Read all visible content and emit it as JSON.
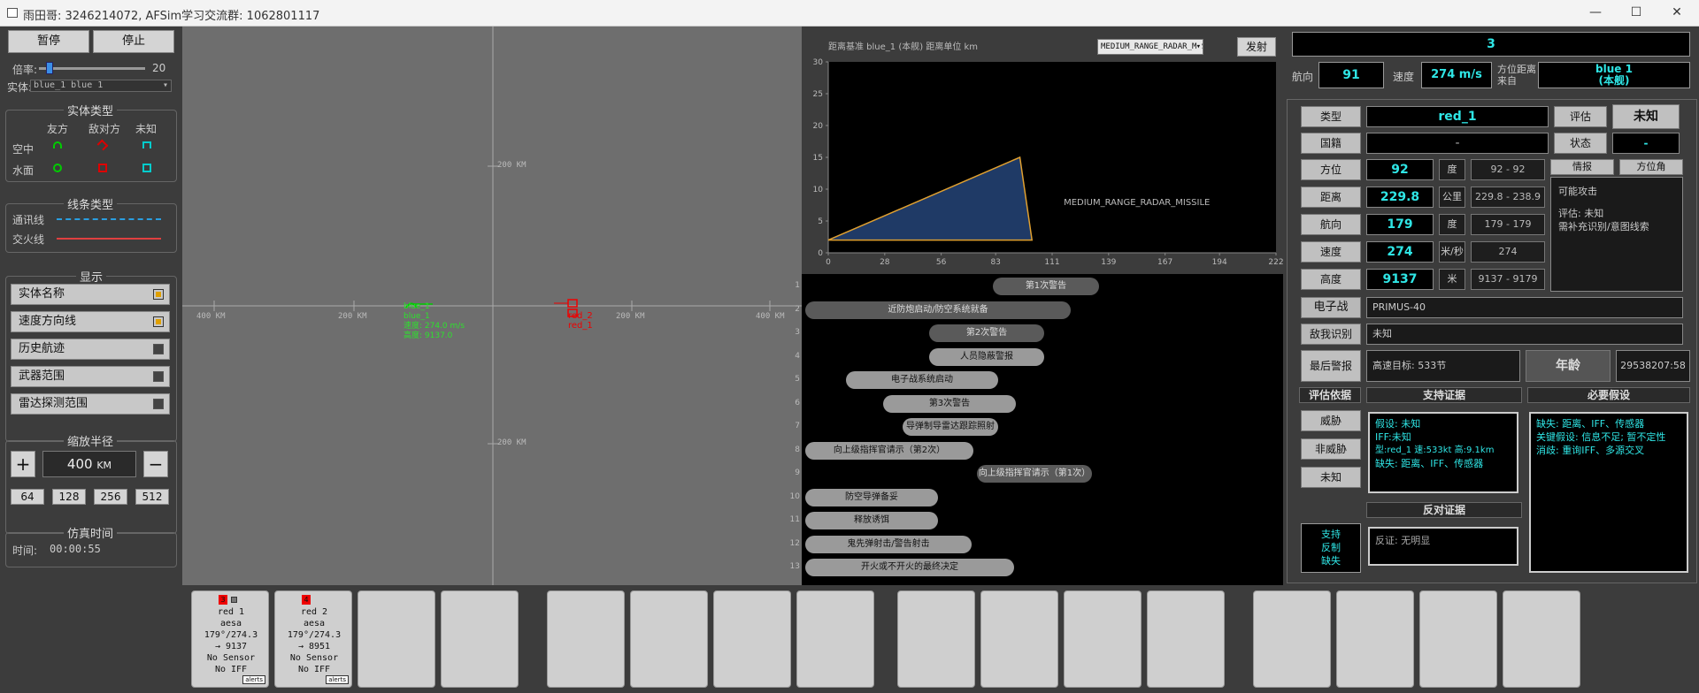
{
  "window": {
    "title": "雨田哥: 3246214072, AFSim学习交流群: 1062801117"
  },
  "left": {
    "pause": "暂停",
    "stop": "停止",
    "rate_label": "倍率:",
    "rate_value": "20",
    "rate_fraction": 0.1,
    "entity_label": "实体:",
    "entity_value": "blue_1 blue 1",
    "entity_types": {
      "title": "实体类型",
      "cols": [
        "友方",
        "敌对方",
        "未知"
      ],
      "rows": [
        "空中",
        "水面"
      ]
    },
    "line_types": {
      "title": "线条类型",
      "comm": "通讯线",
      "engage": "交火线"
    },
    "display": {
      "title": "显示",
      "items": [
        {
          "label": "实体名称",
          "on": true
        },
        {
          "label": "速度方向线",
          "on": true
        },
        {
          "label": "历史航迹",
          "on": false
        },
        {
          "label": "武器范围",
          "on": false
        },
        {
          "label": "雷达探测范围",
          "on": false
        }
      ]
    },
    "zoom": {
      "title": "缩放半径",
      "plus": "+",
      "minus": "−",
      "value": "400",
      "unit": "KM",
      "presets": [
        "64",
        "128",
        "256",
        "512"
      ]
    },
    "sim": {
      "title": "仿真时间",
      "label": "时间:",
      "value": "00:00:55"
    }
  },
  "map": {
    "labels": [
      "400 KM",
      "200 KM",
      "200 KM",
      "400 KM",
      "200 KM",
      "200 KM"
    ],
    "blue": {
      "name": "blue_1",
      "lines": [
        "blue_1",
        "blue_1",
        "速度: 274.0 m/s",
        "高度: 9137.0"
      ]
    },
    "red": [
      "red_2",
      "red_1"
    ]
  },
  "chart": {
    "header": "距离基准 blue_1 (本舰)   距离单位 km",
    "select": "MEDIUM_RANGE_RADAR_MIS",
    "fire": "发射",
    "shape_label": "MEDIUM_RANGE_RADAR_MISSILE",
    "yticks": [
      "0",
      "5",
      "10",
      "15",
      "20",
      "25",
      "30"
    ],
    "xticks": [
      "0",
      "28",
      "56",
      "83",
      "111",
      "139",
      "167",
      "194",
      "222"
    ]
  },
  "chart_data": {
    "type": "area",
    "title": "",
    "xlabel": "",
    "ylabel": "",
    "xlim": [
      0,
      222
    ],
    "ylim": [
      0,
      30
    ],
    "series": [
      {
        "name": "MEDIUM_RANGE_RADAR_MISSILE",
        "x": [
          0,
          95,
          101,
          0
        ],
        "y": [
          2,
          15,
          2,
          2
        ]
      }
    ],
    "area_color": "#1f3a66",
    "edge_color": "#e0a030"
  },
  "timeline": [
    {
      "n": "1",
      "label": "第1次警告",
      "dark": true
    },
    {
      "n": "2",
      "label": "近防炮启动/防空系统就备",
      "dark": true
    },
    {
      "n": "3",
      "label": "第2次警告",
      "dark": true
    },
    {
      "n": "4",
      "label": "人员隐蔽警报",
      "dark": false
    },
    {
      "n": "5",
      "label": "电子战系统启动",
      "dark": false
    },
    {
      "n": "6",
      "label": "第3次警告",
      "dark": false
    },
    {
      "n": "7",
      "label": "导弹制导雷达跟踪照射",
      "dark": false
    },
    {
      "n": "8",
      "label": "向上级指挥官请示（第2次）",
      "dark": false
    },
    {
      "n": "9",
      "label": "向上级指挥官请示（第1次）",
      "dark": true
    },
    {
      "n": "10",
      "label": "防空导弹备妥",
      "dark": false
    },
    {
      "n": "11",
      "label": "释放诱饵",
      "dark": false
    },
    {
      "n": "12",
      "label": "鬼先弹射击/警告射击",
      "dark": false
    },
    {
      "n": "13",
      "label": "开火或不开火的最终决定",
      "dark": false
    }
  ],
  "right": {
    "count": "3",
    "heading_label": "航向",
    "heading": "91",
    "speed_label": "速度",
    "speed": "274 m/s",
    "ref_label": "方位距离\n来自",
    "ref_value": "blue 1\n(本舰)",
    "type_label": "类型",
    "type_value": "red_1",
    "eval_label": "评估",
    "eval_value": "未知",
    "nation_label": "国籍",
    "nation_value": "-",
    "state_label": "状态",
    "state_value": "-",
    "tab_intel": "情报",
    "tab_bearing": "方位角",
    "rows": [
      {
        "label": "方位",
        "value": "92",
        "unit": "度",
        "range": "92 - 92"
      },
      {
        "label": "距离",
        "value": "229.8",
        "unit": "公里",
        "range": "229.8 - 238.9"
      },
      {
        "label": "航向",
        "value": "179",
        "unit": "度",
        "range": "179 - 179"
      },
      {
        "label": "速度",
        "value": "274",
        "unit": "米/秒",
        "range": "274"
      },
      {
        "label": "高度",
        "value": "9137",
        "unit": "米",
        "range": "9137 - 9179"
      }
    ],
    "intel_text": [
      "可能攻击",
      "",
      "评估: 未知",
      "需补充识别/意图线索"
    ],
    "ew_label": "电子战",
    "ew_value": "PRIMUS-40",
    "iff_label": "敌我识别",
    "iff_value": "未知",
    "lastwarn_label": "最后警报",
    "lastwarn_value": "高速目标: 533节",
    "age_label": "年龄",
    "age_value": "29538207:58",
    "basis_title": "评估依据",
    "support_title": "支持证据",
    "assume_title": "必要假设",
    "basis_buttons": [
      "威胁",
      "非威胁",
      "未知"
    ],
    "support_lines": [
      "假设: 未知",
      "IFF:未知",
      "型:red_1 速:533kt 高:9.1km",
      "缺失: 距离、IFF、传感器"
    ],
    "assume_lines": [
      "缺失: 距离、IFF、传感器",
      "关键假设: 信息不足; 暂不定性",
      "消歧: 重询IFF、多源交叉"
    ],
    "counter_title": "反对证据",
    "counter_side": [
      "支持",
      "反制",
      "缺失"
    ],
    "counter_text": "反证: 无明显"
  },
  "tray": {
    "cards": [
      {
        "badge": "3",
        "name": "red 1",
        "type": "aesa",
        "cs": "179°/274.3",
        "alt": "→ 9137",
        "sensor": "No Sensor",
        "iff": "No IFF",
        "alerts": "alerts"
      },
      {
        "badge": "4",
        "name": "red 2",
        "type": "aesa",
        "cs": "179°/274.3",
        "alt": "→ 8951",
        "sensor": "No Sensor",
        "iff": "No IFF",
        "alerts": "alerts"
      }
    ]
  }
}
